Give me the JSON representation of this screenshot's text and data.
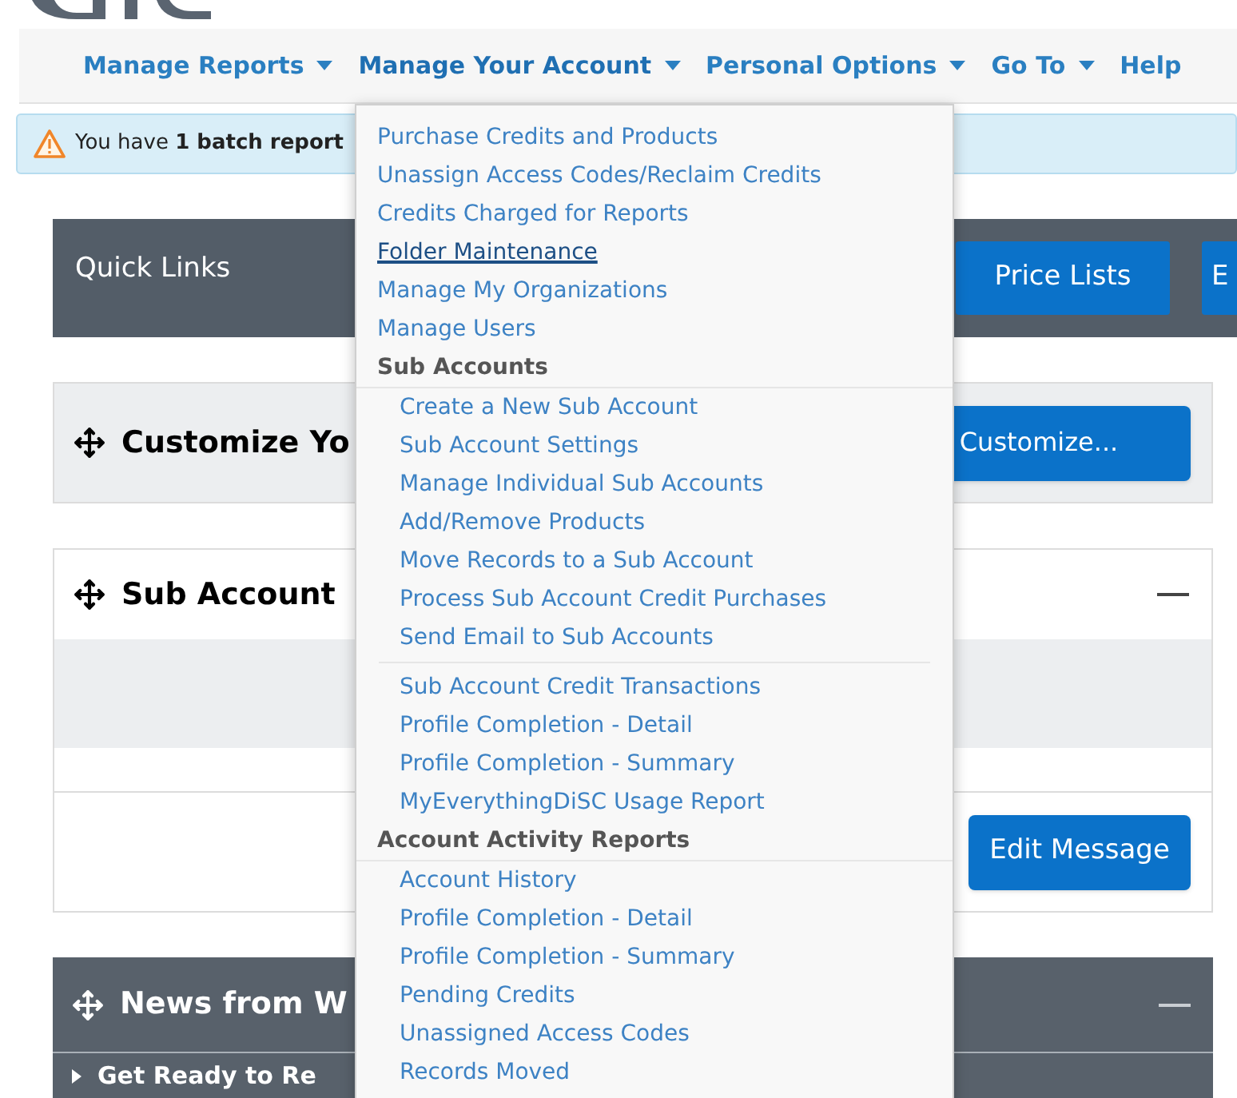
{
  "nav": [
    {
      "label": "Manage Reports",
      "kind": "menu",
      "expanded": false
    },
    {
      "label": "Manage Your Account",
      "kind": "menu",
      "expanded": true
    },
    {
      "label": "Personal Options",
      "kind": "menu",
      "expanded": false
    },
    {
      "label": "Go To",
      "kind": "menu",
      "expanded": false
    },
    {
      "label": "Help",
      "kind": "link",
      "expanded": false
    }
  ],
  "alert": {
    "text": "You have **1 batch report**"
  },
  "quick_links": {
    "title": "Quick Links",
    "buttons": [
      "Price Lists",
      "E"
    ]
  },
  "customize_panel": {
    "title": "Customize Yo",
    "button": "Customize..."
  },
  "sub_account_panel": {
    "title": "Sub Account",
    "button": "Edit Message"
  },
  "news_panel": {
    "title": "News from W",
    "item": "Get Ready to Re"
  },
  "dropdown": [
    {
      "kind": "link",
      "label": "Purchase Credits and Products",
      "hovered": false
    },
    {
      "kind": "link",
      "label": "Unassign Access Codes/Reclaim Credits",
      "hovered": false
    },
    {
      "kind": "link",
      "label": "Credits Charged for Reports",
      "hovered": false
    },
    {
      "kind": "link",
      "label": "Folder Maintenance",
      "hovered": true
    },
    {
      "kind": "link",
      "label": "Manage My Organizations",
      "hovered": false
    },
    {
      "kind": "link",
      "label": "Manage Users",
      "hovered": false
    },
    {
      "kind": "header",
      "label": "Sub Accounts"
    },
    {
      "kind": "sublink",
      "label": "Create a New Sub Account",
      "hovered": false
    },
    {
      "kind": "sublink",
      "label": "Sub Account Settings",
      "hovered": false
    },
    {
      "kind": "sublink",
      "label": "Manage Individual Sub Accounts",
      "hovered": false
    },
    {
      "kind": "sublink",
      "label": "Add/Remove Products",
      "hovered": false
    },
    {
      "kind": "sublink",
      "label": "Move Records to a Sub Account",
      "hovered": false
    },
    {
      "kind": "sublink",
      "label": "Process Sub Account Credit Purchases",
      "hovered": false
    },
    {
      "kind": "sublink",
      "label": "Send Email to Sub Accounts",
      "hovered": false
    },
    {
      "kind": "divider"
    },
    {
      "kind": "sublink",
      "label": "Sub Account Credit Transactions",
      "hovered": false
    },
    {
      "kind": "sublink",
      "label": "Profile Completion - Detail",
      "hovered": false
    },
    {
      "kind": "sublink",
      "label": "Profile Completion - Summary",
      "hovered": false
    },
    {
      "kind": "sublink",
      "label": "MyEverythingDiSC Usage Report",
      "hovered": false
    },
    {
      "kind": "header",
      "label": "Account Activity Reports"
    },
    {
      "kind": "sublink",
      "label": "Account History",
      "hovered": false
    },
    {
      "kind": "sublink",
      "label": "Profile Completion - Detail",
      "hovered": false
    },
    {
      "kind": "sublink",
      "label": "Profile Completion - Summary",
      "hovered": false
    },
    {
      "kind": "sublink",
      "label": "Pending Credits",
      "hovered": false
    },
    {
      "kind": "sublink",
      "label": "Unassigned Access Codes",
      "hovered": false
    },
    {
      "kind": "sublink",
      "label": "Records Moved",
      "hovered": false
    }
  ]
}
